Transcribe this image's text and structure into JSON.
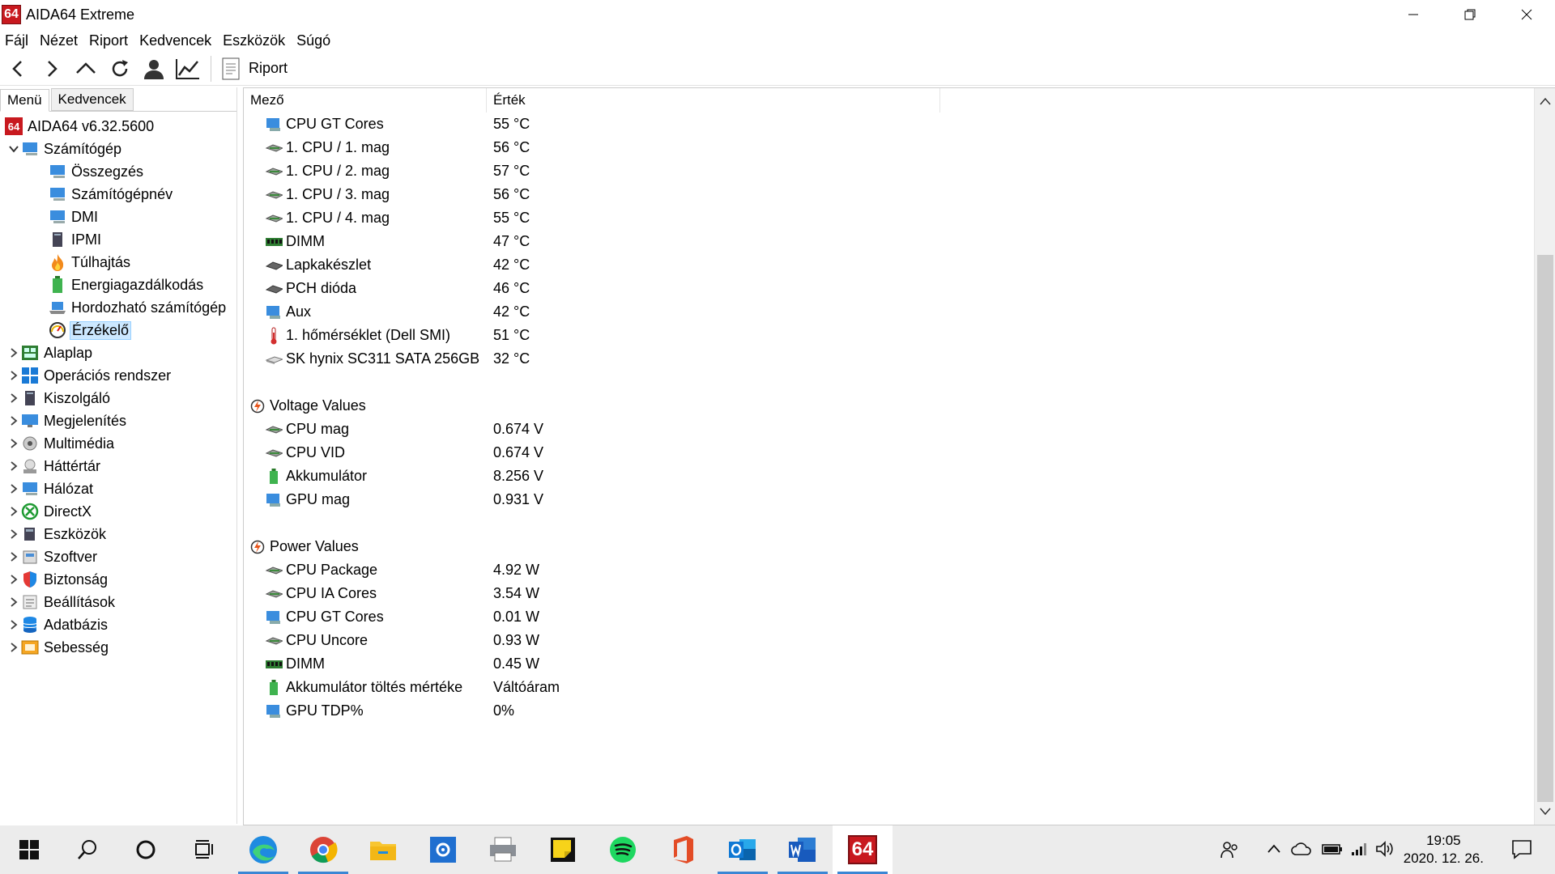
{
  "window": {
    "title": "AIDA64 Extreme"
  },
  "menubar": [
    "Fájl",
    "Nézet",
    "Riport",
    "Kedvencek",
    "Eszközök",
    "Súgó"
  ],
  "toolbar": {
    "report_label": "Riport"
  },
  "left_tabs": {
    "menu": "Menü",
    "favorites": "Kedvencek"
  },
  "tree": {
    "root": "AIDA64 v6.32.5600",
    "computer": "Számítógép",
    "computer_children": [
      "Összegzés",
      "Számítógépnév",
      "DMI",
      "IPMI",
      "Túlhajtás",
      "Energiagazdálkodás",
      "Hordozható számítógép",
      "Érzékelő"
    ],
    "categories": [
      "Alaplap",
      "Operációs rendszer",
      "Kiszolgáló",
      "Megjelenítés",
      "Multimédia",
      "Háttértár",
      "Hálózat",
      "DirectX",
      "Eszközök",
      "Szoftver",
      "Biztonság",
      "Beállítások",
      "Adatbázis",
      "Sebesség"
    ]
  },
  "columns": {
    "field": "Mező",
    "value": "Érték"
  },
  "temperature_rows": [
    {
      "field": "CPU GT Cores",
      "value": "55 °C",
      "icon": "gpu-icon"
    },
    {
      "field": "1. CPU / 1. mag",
      "value": "56 °C",
      "icon": "cpu-chip-icon"
    },
    {
      "field": "1. CPU / 2. mag",
      "value": "57 °C",
      "icon": "cpu-chip-icon"
    },
    {
      "field": "1. CPU / 3. mag",
      "value": "56 °C",
      "icon": "cpu-chip-icon"
    },
    {
      "field": "1. CPU / 4. mag",
      "value": "55 °C",
      "icon": "cpu-chip-icon"
    },
    {
      "field": "DIMM",
      "value": "47 °C",
      "icon": "ram-icon"
    },
    {
      "field": "Lapkakészlet",
      "value": "42 °C",
      "icon": "chipset-icon"
    },
    {
      "field": "PCH dióda",
      "value": "46 °C",
      "icon": "chipset-icon"
    },
    {
      "field": "Aux",
      "value": "42 °C",
      "icon": "monitor-icon"
    },
    {
      "field": "1. hőmérséklet (Dell SMI)",
      "value": "51 °C",
      "icon": "thermometer-icon"
    },
    {
      "field": "SK hynix SC311 SATA 256GB",
      "value": "32 °C",
      "icon": "disk-icon"
    }
  ],
  "voltage_group": "Voltage Values",
  "voltage_rows": [
    {
      "field": "CPU mag",
      "value": "0.674 V",
      "icon": "cpu-chip-icon"
    },
    {
      "field": "CPU VID",
      "value": "0.674 V",
      "icon": "cpu-chip-icon"
    },
    {
      "field": "Akkumulátor",
      "value": "8.256 V",
      "icon": "battery-icon"
    },
    {
      "field": "GPU mag",
      "value": "0.931 V",
      "icon": "gpu-icon"
    }
  ],
  "power_group": "Power Values",
  "power_rows": [
    {
      "field": "CPU Package",
      "value": "4.92 W",
      "icon": "cpu-chip-icon"
    },
    {
      "field": "CPU IA Cores",
      "value": "3.54 W",
      "icon": "cpu-chip-icon"
    },
    {
      "field": "CPU GT Cores",
      "value": "0.01 W",
      "icon": "gpu-icon"
    },
    {
      "field": "CPU Uncore",
      "value": "0.93 W",
      "icon": "cpu-chip-icon"
    },
    {
      "field": "DIMM",
      "value": "0.45 W",
      "icon": "ram-icon"
    },
    {
      "field": "Akkumulátor töltés mértéke",
      "value": "Váltóáram",
      "icon": "battery-icon"
    },
    {
      "field": "GPU TDP%",
      "value": "0%",
      "icon": "gpu-icon"
    }
  ],
  "taskbar": {
    "time": "19:05",
    "date": "2020. 12. 26.",
    "aida_label": "64"
  },
  "colors": {
    "accent": "#c8191f",
    "selection": "#cce8ff",
    "taskbar": "#ececec"
  }
}
